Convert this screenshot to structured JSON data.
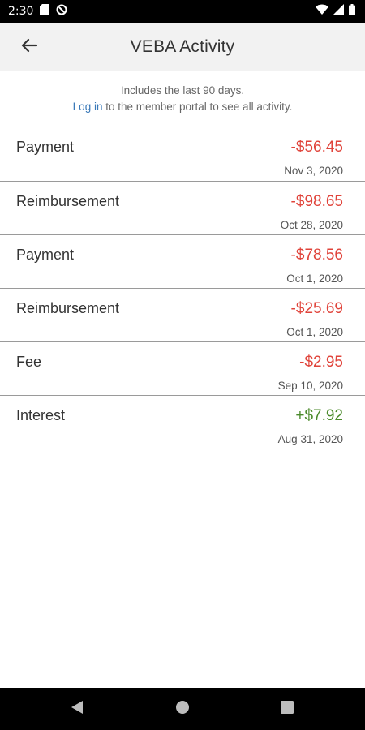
{
  "status": {
    "time": "2:30"
  },
  "header": {
    "title": "VEBA Activity"
  },
  "intro": {
    "line1": "Includes the last 90 days.",
    "login_link": "Log in",
    "line2_rest": " to the member portal to see all activity."
  },
  "colors": {
    "negative": "#e0433a",
    "positive": "#4a8a2a"
  },
  "transactions": [
    {
      "type": "Payment",
      "amount": "-$56.45",
      "date": "Nov 3, 2020",
      "sign": "negative"
    },
    {
      "type": "Reimbursement",
      "amount": "-$98.65",
      "date": "Oct 28, 2020",
      "sign": "negative"
    },
    {
      "type": "Payment",
      "amount": "-$78.56",
      "date": "Oct 1, 2020",
      "sign": "negative"
    },
    {
      "type": "Reimbursement",
      "amount": "-$25.69",
      "date": "Oct 1, 2020",
      "sign": "negative"
    },
    {
      "type": "Fee",
      "amount": "-$2.95",
      "date": "Sep 10, 2020",
      "sign": "negative"
    },
    {
      "type": "Interest",
      "amount": "+$7.92",
      "date": "Aug 31, 2020",
      "sign": "positive"
    }
  ]
}
